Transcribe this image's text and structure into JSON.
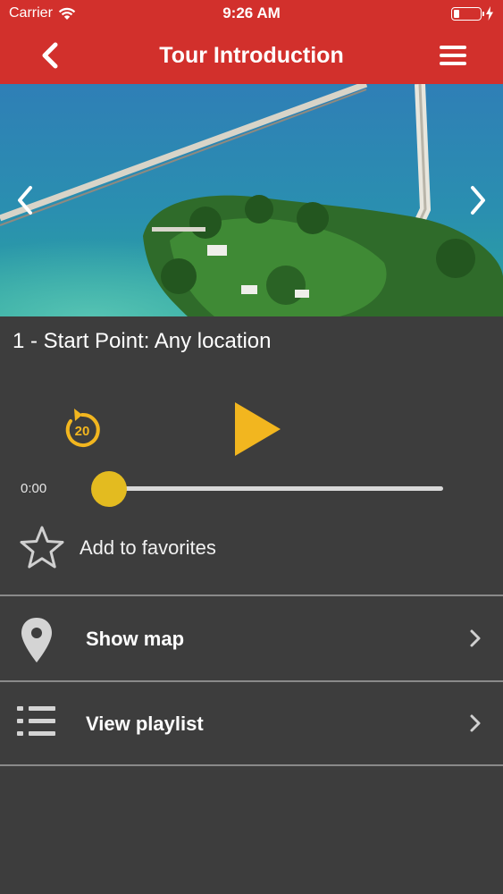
{
  "status_bar": {
    "carrier": "Carrier",
    "time": "9:26 AM"
  },
  "nav": {
    "title": "Tour Introduction",
    "back_icon": "chevron-left-icon",
    "menu_icon": "hamburger-menu-icon"
  },
  "hero": {
    "image": "aerial-bridge-island-photo",
    "prev_icon": "chevron-left-icon",
    "next_icon": "chevron-right-icon"
  },
  "track": {
    "title": "1 - Start Point: Any location"
  },
  "player": {
    "rewind_seconds": "20",
    "current_time": "0:00",
    "progress": 0,
    "accent_color": "#e3bb20"
  },
  "favorites": {
    "label": "Add to favorites",
    "icon": "star-outline-icon"
  },
  "menu_items": [
    {
      "label": "Show map",
      "icon": "map-pin-icon"
    },
    {
      "label": "View playlist",
      "icon": "list-icon"
    }
  ],
  "colors": {
    "header": "#d2302c",
    "background": "#3d3d3d",
    "accent": "#f2b61f"
  }
}
